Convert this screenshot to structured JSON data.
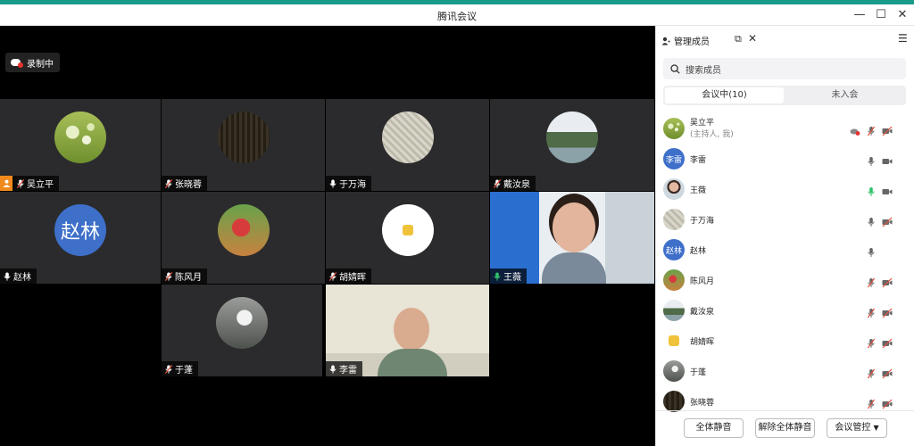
{
  "window": {
    "title": "腾讯会议"
  },
  "stage": {
    "recording_label": "录制中",
    "tiles": [
      {
        "name": "吴立平",
        "host": true,
        "mic": "muted",
        "avatar": "dandelion"
      },
      {
        "name": "张晓蓉",
        "mic": "muted",
        "avatar": "dark-forest"
      },
      {
        "name": "于万海",
        "mic": "on",
        "avatar": "woven"
      },
      {
        "name": "戴汝泉",
        "mic": "muted",
        "avatar": "mountain"
      },
      {
        "name": "赵林",
        "mic": "on",
        "avatar_text": "赵林"
      },
      {
        "name": "陈风月",
        "mic": "muted",
        "avatar": "red-flower"
      },
      {
        "name": "胡婧晖",
        "mic": "muted",
        "avatar": "cartoon"
      },
      {
        "name": "王薇",
        "mic": "speaking",
        "video": "woman"
      },
      {
        "name": "于蓬",
        "mic": "muted",
        "avatar": "bird"
      },
      {
        "name": "李雷",
        "mic": "on",
        "video": "man"
      }
    ]
  },
  "panel": {
    "title": "管理成员",
    "search_placeholder": "搜索成员",
    "tab_in_meeting": "会议中(10)",
    "tab_not_joined": "未入会",
    "members": [
      {
        "name": "吴立平",
        "sub": "(主持人, 我)",
        "avatar": "dandelion",
        "mic": "muted",
        "cam": "off",
        "rec": true
      },
      {
        "name": "李雷",
        "avatar_text": "李雷",
        "mic": "on",
        "cam": "on"
      },
      {
        "name": "王薇",
        "avatar": "woman",
        "mic": "speaking",
        "cam": "on"
      },
      {
        "name": "于万海",
        "avatar": "woven",
        "mic": "on",
        "cam": "off"
      },
      {
        "name": "赵林",
        "avatar_text": "赵林",
        "mic": "on",
        "cam": "none"
      },
      {
        "name": "陈风月",
        "avatar": "red-flower",
        "mic": "muted",
        "cam": "off"
      },
      {
        "name": "戴汝泉",
        "avatar": "mountain",
        "mic": "muted",
        "cam": "off"
      },
      {
        "name": "胡婧晖",
        "avatar": "cartoon",
        "mic": "muted",
        "cam": "off"
      },
      {
        "name": "于蓬",
        "avatar": "bird",
        "mic": "muted",
        "cam": "off"
      },
      {
        "name": "张晓蓉",
        "avatar": "dark-forest",
        "mic": "muted",
        "cam": "off"
      }
    ],
    "footer": {
      "mute_all": "全体静音",
      "unmute_all": "解除全体静音",
      "meeting_control": "会议管控"
    }
  },
  "colors": {
    "accent": "#2fc26a",
    "muted": "#e0523f",
    "avatar_blue": "#3e6fc9",
    "host_orange": "#f08a1c"
  }
}
